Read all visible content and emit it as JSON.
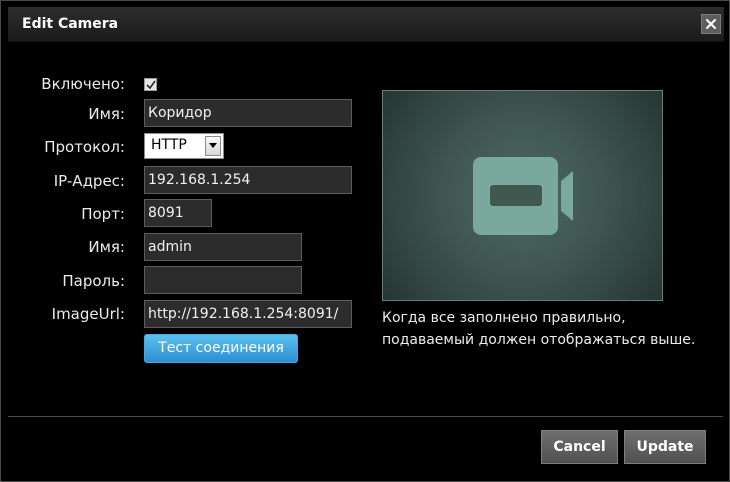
{
  "dialog": {
    "title": "Edit Camera",
    "close_icon": "close-icon"
  },
  "form": {
    "enabled_label": "Включено:",
    "enabled_checked": true,
    "name_label": "Имя:",
    "name_value": "Коридор",
    "protocol_label": "Протокол:",
    "protocol_value": "HTTP",
    "ip_label": "IP-Адрес:",
    "ip_value": "192.168.1.254",
    "port_label": "Порт:",
    "port_value": "8091",
    "login_label": "Имя:",
    "login_value": "admin",
    "password_label": "Пароль:",
    "password_value": "",
    "image_url_label": "ImageUrl:",
    "image_url_value": "http://192.168.1.254:8091/",
    "test_button_label": "Тест соединения"
  },
  "preview": {
    "icon": "video-camera-icon",
    "help_text_line1": "Когда все заполнено правильно,",
    "help_text_line2": "подаваемый должен отображаться выше."
  },
  "footer": {
    "cancel_label": "Cancel",
    "update_label": "Update"
  },
  "colors": {
    "accent_button": "#2c8ed3",
    "preview_bg": "#3f5652",
    "camera_icon": "#79a89c"
  }
}
